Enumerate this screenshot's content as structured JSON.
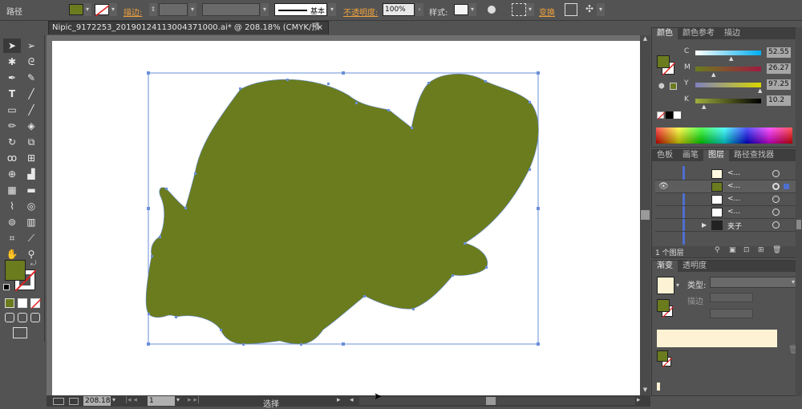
{
  "control_bar": {
    "mode_label": "路径",
    "stroke_label": "描边:",
    "stroke_style": "基本",
    "opacity_label": "不透明度:",
    "opacity_value": "100%",
    "style_label": "样式:",
    "transform_label": "变换",
    "fill_color": "#6b7c1f"
  },
  "document": {
    "tab_title": "Nipic_9172253_20190124113004371000.ai* @ 208.18% (CMYK/预览)",
    "close_glyph": "×"
  },
  "status_bar": {
    "zoom": "208.18",
    "artboard": "1",
    "tool_status": "选择"
  },
  "color_panel": {
    "tabs": [
      "颜色",
      "颜色参考",
      "描边"
    ],
    "sliders": [
      {
        "label": "C",
        "value": "52.55",
        "fraction": 0.52,
        "color_start": "#ffffff",
        "color_end": "#00aeef"
      },
      {
        "label": "M",
        "value": "26.27",
        "fraction": 0.26,
        "color_start": "#6b7c1f",
        "color_end": "#a01a40"
      },
      {
        "label": "Y",
        "value": "97.25",
        "fraction": 0.97,
        "color_start": "#8080c0",
        "color_end": "#d8d800"
      },
      {
        "label": "K",
        "value": "10.2",
        "fraction": 0.1,
        "color_start": "#9fae3d",
        "color_end": "#000000"
      }
    ]
  },
  "layers_panel": {
    "tabs": [
      "色板",
      "画笔",
      "图层",
      "路径查找器"
    ],
    "rows": [
      {
        "name": "<...",
        "thumb_color": "#fff8e0"
      },
      {
        "name": "<...",
        "thumb_color": "#6b7c1f"
      },
      {
        "name": "<...",
        "thumb_color": "#ffffff"
      },
      {
        "name": "<...",
        "thumb_color": "#ffffff"
      },
      {
        "name": "夹子",
        "thumb_color": "#222222"
      }
    ],
    "footer": "1 个图层"
  },
  "gradient_panel": {
    "tabs": [
      "渐变",
      "透明度"
    ],
    "type_label": "类型:",
    "stroke_label": "描边"
  },
  "colors": {
    "accent_green": "#6b7c1f",
    "selection_blue": "#6a8fd8"
  }
}
